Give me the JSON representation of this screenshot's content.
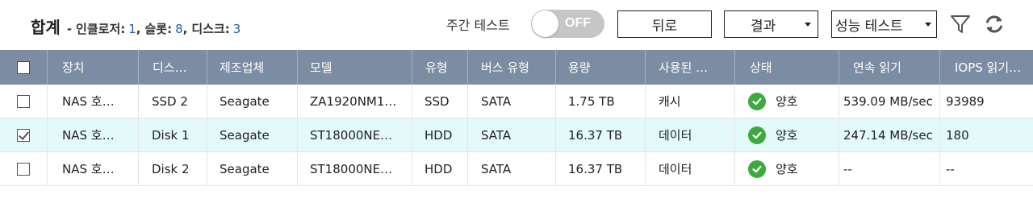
{
  "summary": {
    "title": "합계",
    "dash": "-",
    "enclosure_label": "인클로저:",
    "enclosure_count": "1",
    "slot_label": "슬롯:",
    "slot_count": "8",
    "disk_label": "디스크:",
    "disk_count": "3",
    "comma": ","
  },
  "toolbar": {
    "weekly_test_label": "주간 테스트",
    "toggle_state": "OFF",
    "back_label": "뒤로",
    "result_label": "결과",
    "perf_test_label": "성능 테스트"
  },
  "icons": {
    "filter": "filter-icon",
    "refresh": "refresh-icon",
    "status_ok": "check-circle-icon",
    "ok_color": "#3caa3c",
    "header_color": "#7c8da3",
    "selected_row_color": "#e4fafa"
  },
  "table": {
    "columns": [
      "장치",
      "디스…",
      "제조업체",
      "모델",
      "유형",
      "버스 유형",
      "용량",
      "사용된 …",
      "상태",
      "연속 읽기",
      "IOPS 읽기…"
    ],
    "rows": [
      {
        "checked": false,
        "device": "NAS 호…",
        "disk": "SSD 2",
        "maker": "Seagate",
        "model": "ZA1920NM1…",
        "type": "SSD",
        "bus": "SATA",
        "capacity": "1.75 TB",
        "used": "캐시",
        "status": "양호",
        "seq_read": "539.09 MB/sec",
        "iops": "93989"
      },
      {
        "checked": true,
        "device": "NAS 호…",
        "disk": "Disk 1",
        "maker": "Seagate",
        "model": "ST18000NE…",
        "type": "HDD",
        "bus": "SATA",
        "capacity": "16.37 TB",
        "used": "데이터",
        "status": "양호",
        "seq_read": "247.14 MB/sec",
        "iops": "180"
      },
      {
        "checked": false,
        "device": "NAS 호…",
        "disk": "Disk 2",
        "maker": "Seagate",
        "model": "ST18000NE…",
        "type": "HDD",
        "bus": "SATA",
        "capacity": "16.37 TB",
        "used": "데이터",
        "status": "양호",
        "seq_read": "--",
        "iops": "--"
      }
    ]
  }
}
